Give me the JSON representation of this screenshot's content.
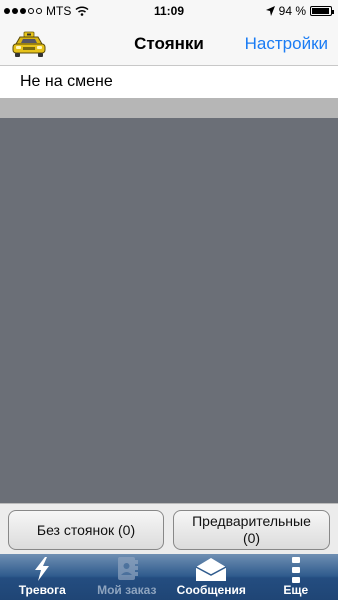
{
  "status_bar": {
    "carrier": "MTS",
    "time": "11:09",
    "battery_percent": "94 %",
    "battery_level": 0.94,
    "signal_bars_filled": 3,
    "signal_bars_total": 5
  },
  "nav_bar": {
    "title": "Стоянки",
    "settings_label": "Настройки",
    "icon": "taxi-icon"
  },
  "shift_status": "Не на смене",
  "buttons": {
    "no_stops": "Без стоянок (0)",
    "preorder_line1": "Предварительные",
    "preorder_line2": "(0)"
  },
  "tabs": [
    {
      "label": "Тревога",
      "icon": "lightning-icon",
      "enabled": true
    },
    {
      "label": "Мой заказ",
      "icon": "address-book-icon",
      "enabled": false
    },
    {
      "label": "Сообщения",
      "icon": "envelope-icon",
      "enabled": true
    },
    {
      "label": "Еще",
      "icon": "more-icon",
      "enabled": true
    }
  ],
  "colors": {
    "accent": "#1a7cf4",
    "map_area": "#6b6f77",
    "tab_bar": "#2f5b8d"
  }
}
